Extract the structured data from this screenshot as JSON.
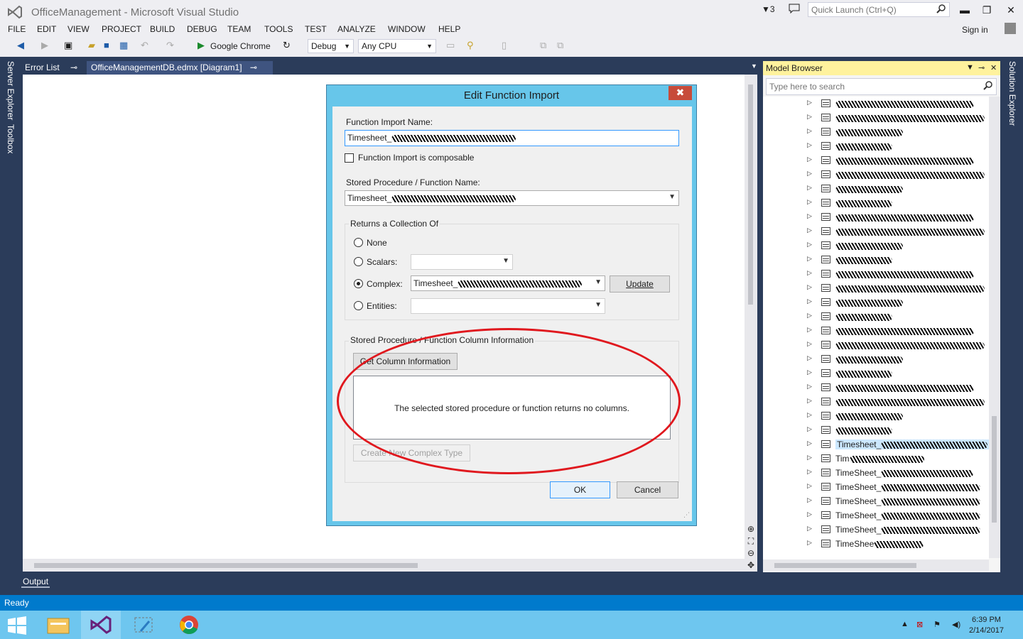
{
  "window": {
    "title": "OfficeManagement - Microsoft Visual Studio",
    "notification_count": "3",
    "quick_launch_placeholder": "Quick Launch (Ctrl+Q)",
    "sign_in": "Sign in"
  },
  "menu": [
    "FILE",
    "EDIT",
    "VIEW",
    "PROJECT",
    "BUILD",
    "DEBUG",
    "TEAM",
    "TOOLS",
    "TEST",
    "ANALYZE",
    "WINDOW",
    "HELP"
  ],
  "toolbar": {
    "run_target": "Google Chrome",
    "configuration": "Debug",
    "platform": "Any CPU"
  },
  "side_tabs": {
    "left": [
      "Server Explorer",
      "Toolbox"
    ],
    "right": [
      "Solution Explorer"
    ]
  },
  "doc_tabs": [
    "Error List",
    "OfficeManagementDB.edmx [Diagram1]"
  ],
  "model_browser": {
    "title": "Model Browser",
    "search_placeholder": "Type here to search",
    "selected_item": "Timesheet_",
    "visible_items": [
      "Timesheet_",
      "Tim",
      "TimeSheet_",
      "TimeSheet_",
      "TimeSheet_",
      "TimeSheet_",
      "TimeSheet_",
      "TimeShee"
    ]
  },
  "output_tab": "Output",
  "status": "Ready",
  "dialog": {
    "title": "Edit Function Import",
    "close": "✖",
    "function_import_name_label": "Function Import Name:",
    "function_import_name_value": "Timesheet_",
    "composable_label": "Function Import is composable",
    "stored_proc_label": "Stored Procedure / Function Name:",
    "stored_proc_value": "Timesheet_",
    "returns_group": "Returns a Collection Of",
    "opt_none": "None",
    "opt_scalars": "Scalars:",
    "opt_complex": "Complex:",
    "opt_entities": "Entities:",
    "complex_value": "Timesheet_",
    "update_button": "Update",
    "column_info_group": "Stored Procedure / Function Column Information",
    "get_column_info_button": "Get Column Information",
    "no_columns_message": "The selected stored procedure or function returns no columns.",
    "create_complex_button": "Create New Complex Type",
    "ok_button": "OK",
    "cancel_button": "Cancel"
  },
  "taskbar": {
    "time": "6:39 PM",
    "date": "2/14/2017"
  },
  "colors": {
    "titlebar": "#eeeef2",
    "frame": "#2b3c5a",
    "statusbar": "#007acc",
    "dialog_frame": "#67c6ea",
    "highlight_circle": "#e0181e",
    "model_browser_header": "#fff29d"
  }
}
